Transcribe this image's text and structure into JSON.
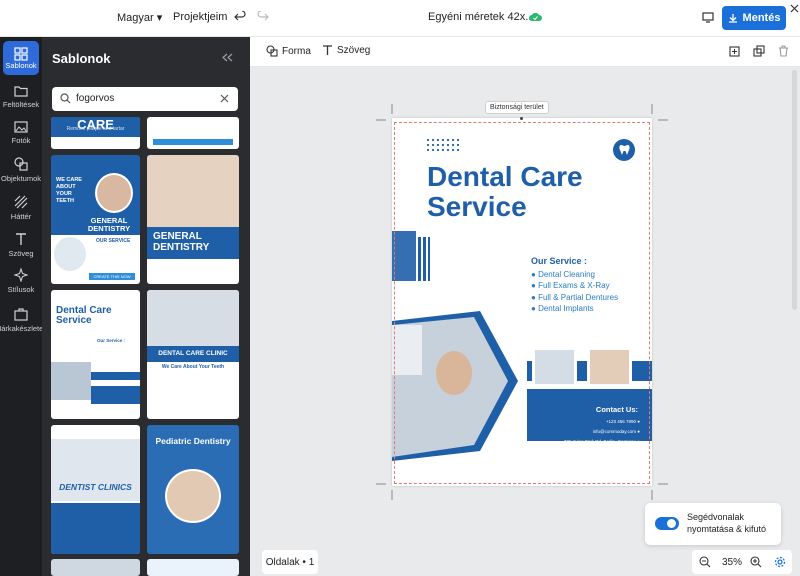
{
  "topbar": {
    "language": "Magyar",
    "projects": "Projektjeim",
    "doc_title": "Egyéni méretek 42x...",
    "share_label": "Mentés"
  },
  "rail": {
    "items": [
      {
        "label": "Sablonok",
        "icon": "templates-icon"
      },
      {
        "label": "Feltöltések",
        "icon": "folder-icon"
      },
      {
        "label": "Fotók",
        "icon": "photo-icon"
      },
      {
        "label": "Objektumok",
        "icon": "shapes-icon"
      },
      {
        "label": "Háttér",
        "icon": "background-icon"
      },
      {
        "label": "Szöveg",
        "icon": "text-icon"
      },
      {
        "label": "Stílusok",
        "icon": "sparkle-icon"
      },
      {
        "label": "Márkakészletek",
        "icon": "brand-icon"
      }
    ]
  },
  "panel": {
    "title": "Sablonok",
    "search_value": "fogorvos"
  },
  "thumbs": {
    "t0": "CARE",
    "t0b": "Remove plaque and tartar",
    "t1_title": "WE CARE ABOUT YOUR TEETH",
    "t1_sub": "GENERAL DENTISTRY",
    "t1_service": "OUR SERVICE",
    "t1_btn": "CREATE THIS NOW",
    "t2_title": "GENERAL DENTISTRY",
    "t3_title": "Dental Care Service",
    "t3_service": "Our Service :",
    "t4_title": "DENTAL CARE CLINIC",
    "t4_sub": "We Care About Your Teeth",
    "t5_title": "DENTIST CLINICS",
    "t6_title": "Pediatric Dentistry"
  },
  "toolbar": {
    "shape_label": "Forma",
    "text_label": "Szöveg"
  },
  "canvas": {
    "safe_area_label": "Biztonsági terület",
    "heading_line1": "Dental Care",
    "heading_line2": "Service",
    "service_title": "Our Service :",
    "services": [
      "Dental Cleaning",
      "Full Exams & X-Ray",
      "Full & Partial Dentures",
      "Dental Implants"
    ],
    "contact_title": "Contact Us:",
    "contacts": [
      "+123 456 7890",
      "info@commoday.com",
      "775 Irving Park Rd, Berlin, Germany"
    ]
  },
  "bottom": {
    "toggle_label_1": "Segédvonalak",
    "toggle_label_2": "nyomtatása & kifutó",
    "pages_label": "Oldalak • 1",
    "zoom_value": "35%"
  },
  "colors": {
    "accent": "#1a6fd8",
    "brand_blue": "#1f5fa8",
    "dark_rail": "#1e1f22",
    "panel": "#2a2c30"
  }
}
